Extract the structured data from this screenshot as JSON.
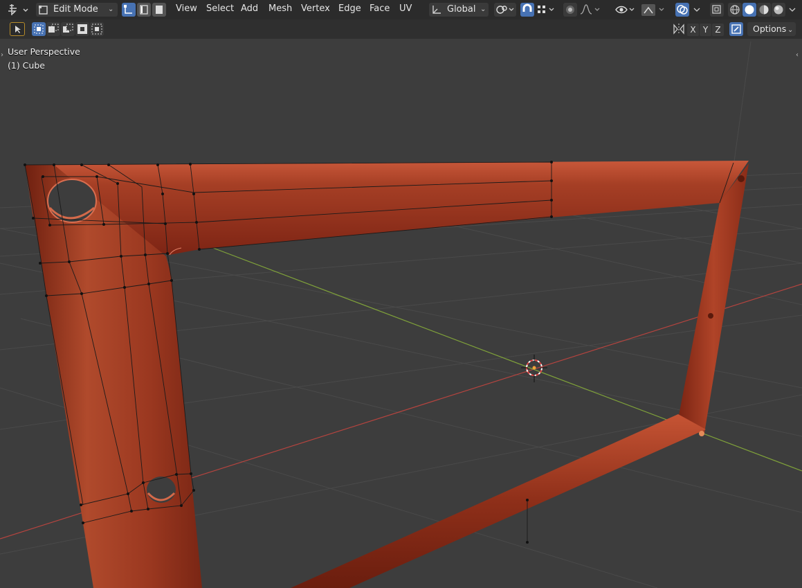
{
  "header": {
    "mode_label": "Edit Mode",
    "menus": [
      "View",
      "Select",
      "Add",
      "Mesh",
      "Vertex",
      "Edge",
      "Face",
      "UV"
    ],
    "orientation_label": "Global"
  },
  "toolbar2": {
    "axis_x": "X",
    "axis_y": "Y",
    "axis_z": "Z",
    "options_label": "Options"
  },
  "viewport": {
    "view_name": "User Perspective",
    "object_name": "(1) Cube"
  },
  "colors": {
    "accent": "#4772b3",
    "header_bg": "#2b2b2b",
    "viewport_bg": "#3d3d3d",
    "mesh": "#a83a22",
    "axis_x": "#b5443f",
    "axis_y": "#7fa13a"
  },
  "icons": [
    "editor-type-icon",
    "edit-mode-icon",
    "vertex-select-icon",
    "edge-select-icon",
    "face-select-icon",
    "transform-orientation-icon",
    "pivot-icon",
    "snap-icon",
    "snap-increment-icon",
    "proportional-icon",
    "falloff-icon",
    "visibility-icon",
    "gizmo-icon",
    "overlay-icon",
    "xray-icon",
    "wireframe-shading-icon",
    "solid-shading-icon",
    "material-shading-icon",
    "rendered-shading-icon",
    "select-box-tool-icon",
    "mirror-icon",
    "3d-cursor-icon"
  ]
}
